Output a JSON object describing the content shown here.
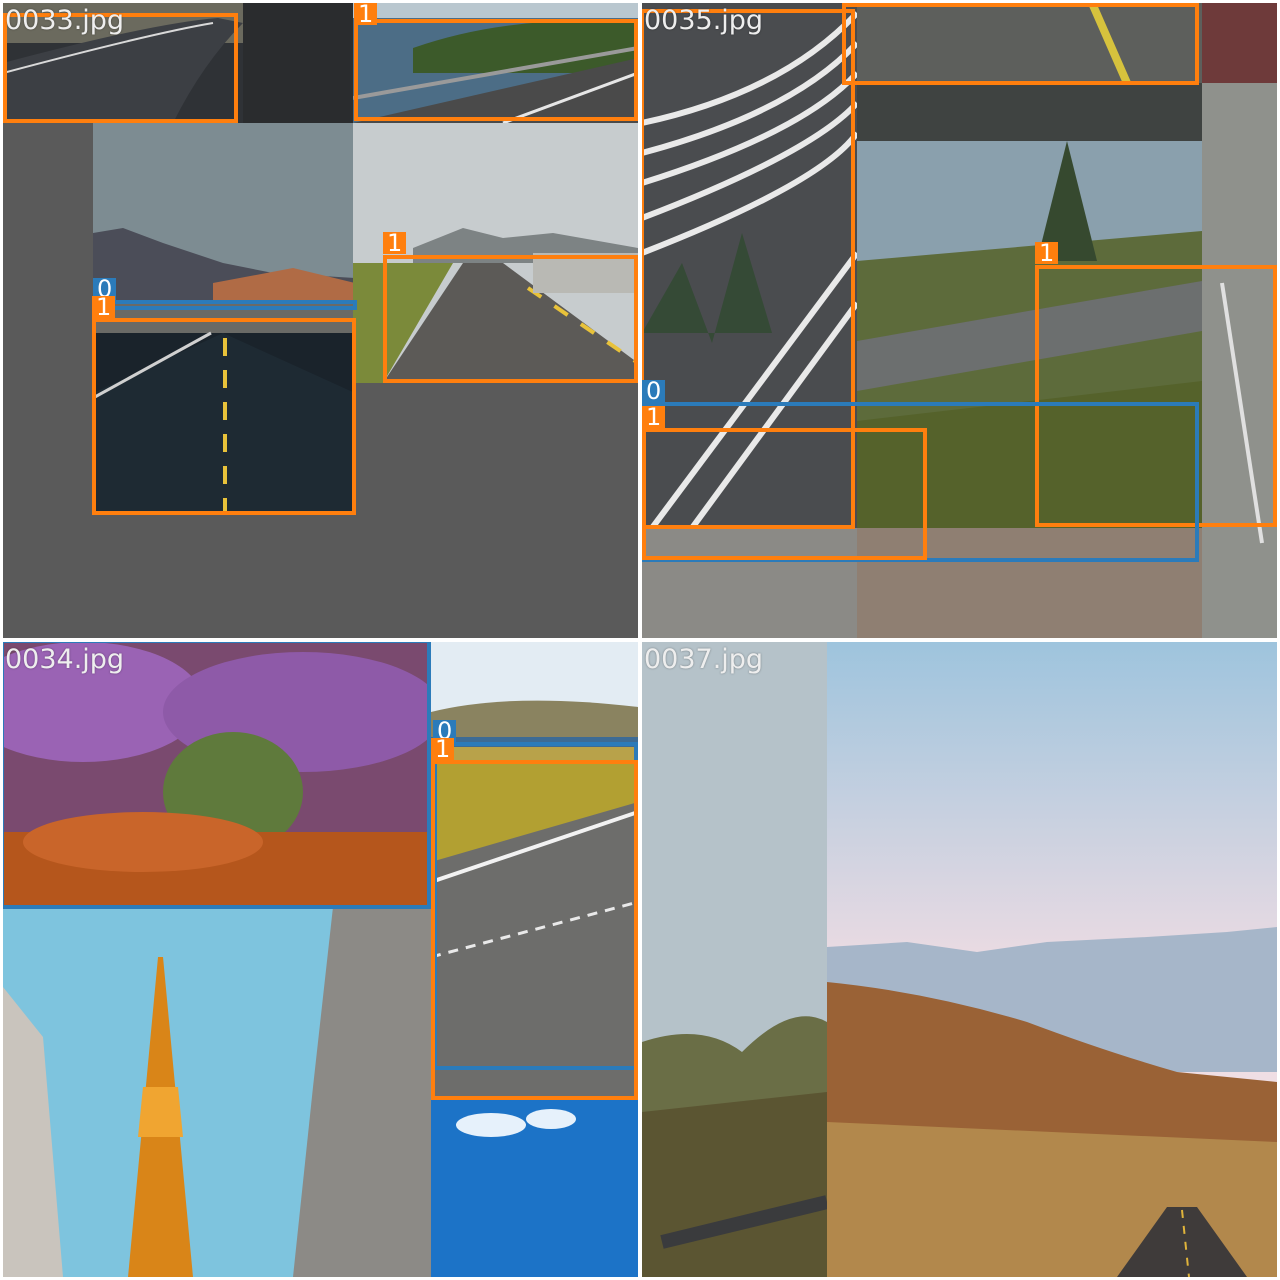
{
  "colors": {
    "class0": "#2b7bba",
    "class1": "#ff7f0e",
    "tile_background": "#5a5a5a"
  },
  "tiles": [
    {
      "filename": "0033.jpg"
    },
    {
      "filename": "0035.jpg"
    },
    {
      "filename": "0034.jpg"
    },
    {
      "filename": "0037.jpg"
    }
  ],
  "class_labels": {
    "class0": "0",
    "class1": "1"
  }
}
